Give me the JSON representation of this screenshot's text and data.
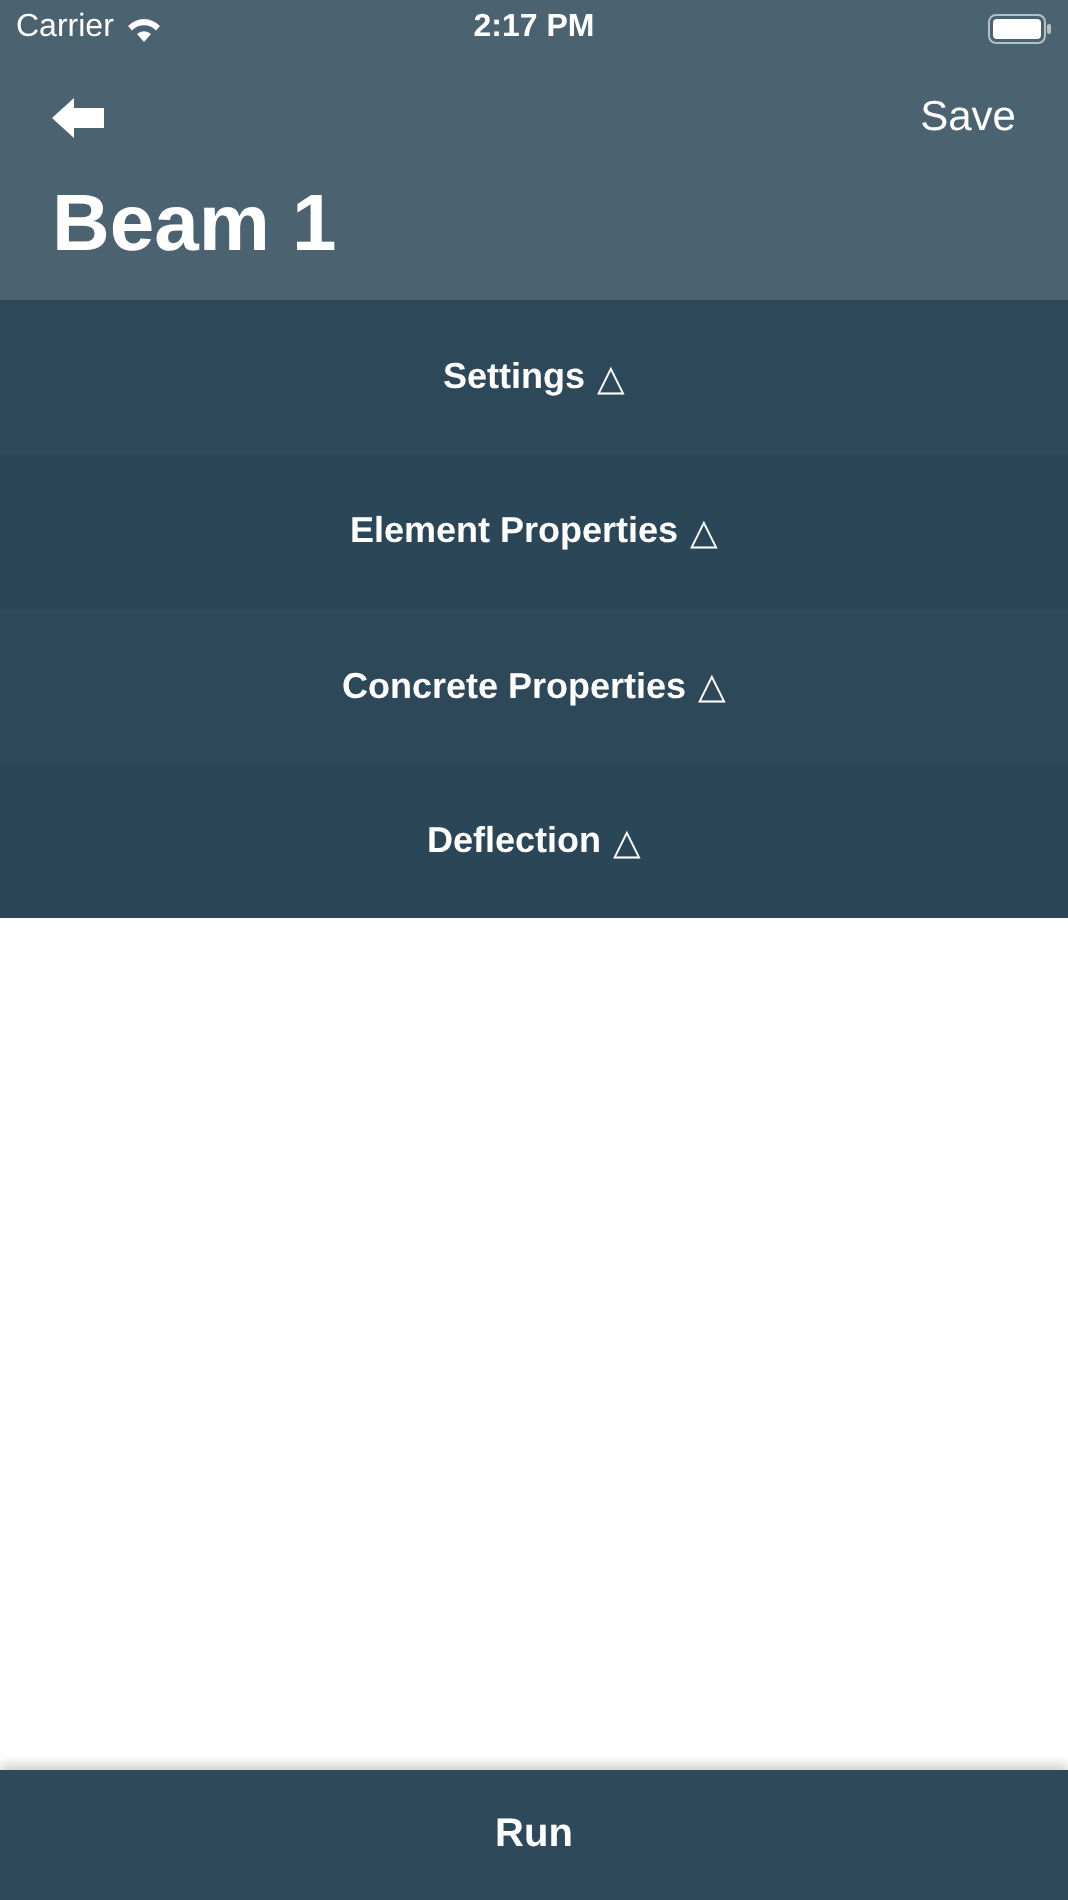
{
  "status_bar": {
    "carrier": "Carrier",
    "time": "2:17 PM"
  },
  "nav": {
    "action": "Save",
    "title": "Beam 1"
  },
  "sections": [
    {
      "label": "Settings",
      "indicator": "△"
    },
    {
      "label": "Element Properties",
      "indicator": "△"
    },
    {
      "label": "Concrete Properties",
      "indicator": "△"
    },
    {
      "label": "Deflection",
      "indicator": "△"
    }
  ],
  "run_button": "Run"
}
